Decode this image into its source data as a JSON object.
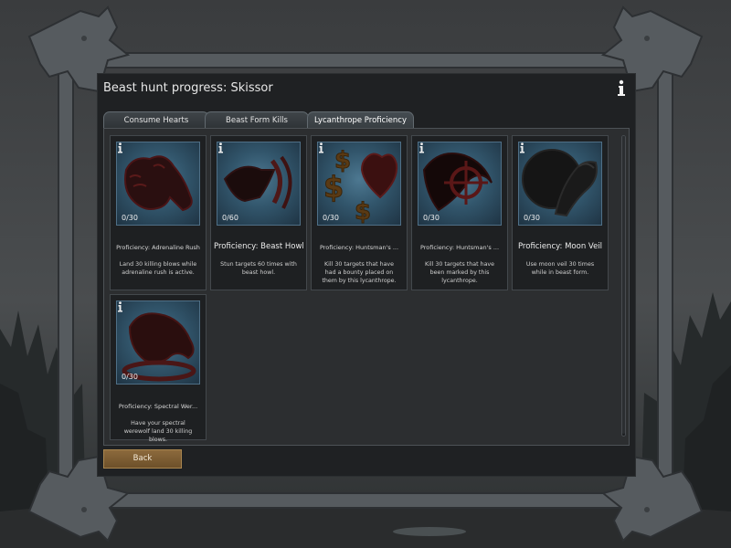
{
  "panel": {
    "title": "Beast hunt progress: Skissor",
    "info_icon": "info-icon"
  },
  "tabs": [
    {
      "label": "Consume Hearts",
      "active": false
    },
    {
      "label": "Beast Form Kills",
      "active": false
    },
    {
      "label": "Lycanthrope Proficiency",
      "active": true
    }
  ],
  "cards": [
    {
      "count": "0/30",
      "title": "Proficiency: Adrenaline Rush",
      "desc": "Land 30 killing blows while adrenaline rush is active.",
      "icon": "adrenaline-claw-icon"
    },
    {
      "count": "0/60",
      "title": "Proficiency: Beast Howl",
      "desc": "Stun targets 60 times with beast howl.",
      "icon": "howl-icon"
    },
    {
      "count": "0/30",
      "title": "Proficiency: Huntsman's ...",
      "desc": "Kill 30 targets that have had a bounty placed on them by this lycanthrope.",
      "icon": "bounty-heart-icon"
    },
    {
      "count": "0/30",
      "title": "Proficiency: Huntsman's ...",
      "desc": "Kill 30 targets that have been marked by this lycanthrope.",
      "icon": "crosshair-claw-icon"
    },
    {
      "count": "0/30",
      "title": "Proficiency: Moon Veil",
      "desc": "Use moon veil 30 times while in beast form.",
      "icon": "moon-wolf-icon"
    },
    {
      "count": "0/30",
      "title": "Proficiency: Spectral Wer...",
      "desc": "Have your spectral werewolf land 30 killing blows.",
      "icon": "spectral-wolf-icon"
    }
  ],
  "buttons": {
    "back_label": "Back"
  },
  "colors": {
    "accent": "#8c6a3c",
    "icon_bg": "#3f6a83",
    "icon_red": "#5a1a1a"
  }
}
